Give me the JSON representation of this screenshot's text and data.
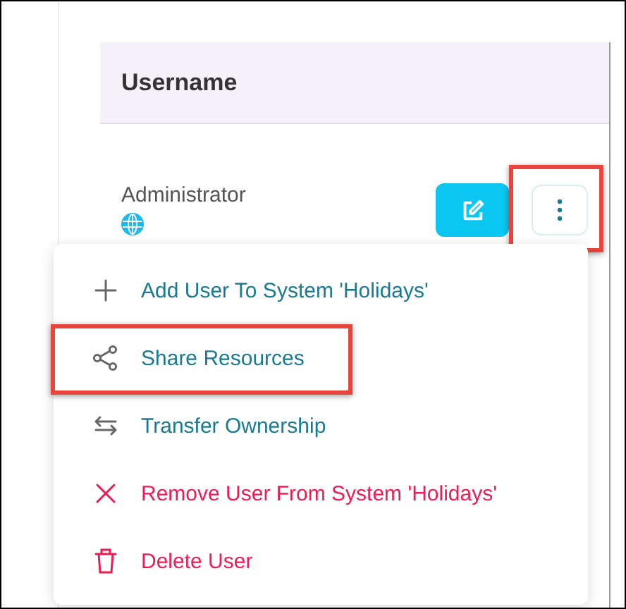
{
  "table": {
    "columns": [
      "Username"
    ],
    "rows": [
      {
        "username": "Administrator",
        "actions_highlighted": true
      }
    ]
  },
  "menu": {
    "items": [
      {
        "label": "Add User To System 'Holidays'",
        "kind": "normal",
        "highlighted": false
      },
      {
        "label": "Share Resources",
        "kind": "normal",
        "highlighted": true
      },
      {
        "label": "Transfer Ownership",
        "kind": "normal",
        "highlighted": false
      },
      {
        "label": "Remove User From System 'Holidays'",
        "kind": "danger",
        "highlighted": false
      },
      {
        "label": "Delete User",
        "kind": "danger",
        "highlighted": false
      }
    ]
  }
}
